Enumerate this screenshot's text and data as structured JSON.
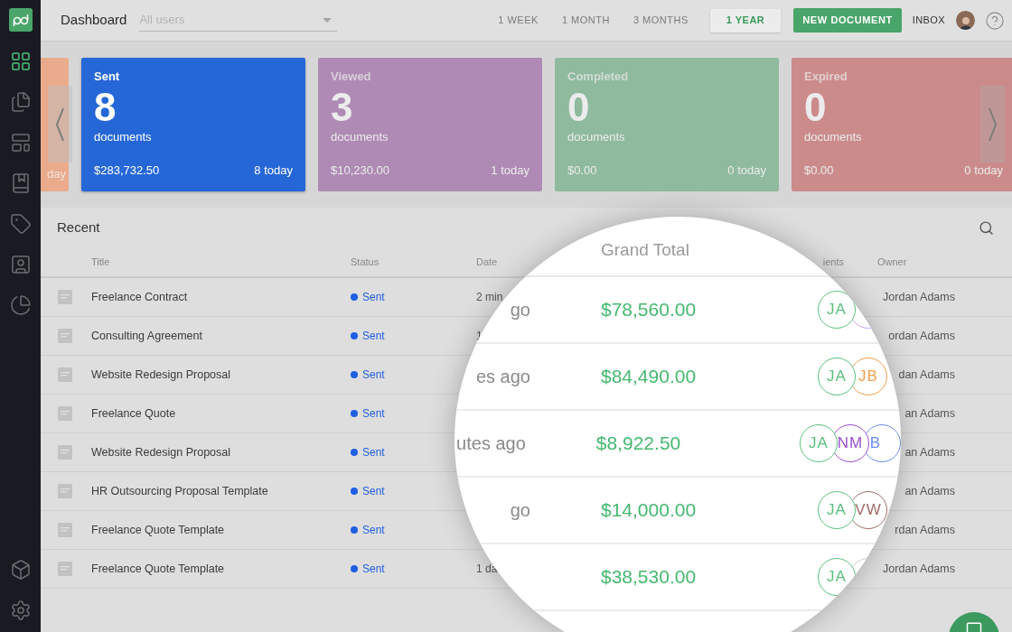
{
  "sidebar": {
    "items": [
      {
        "kind": "dashboard",
        "selected": true
      },
      {
        "kind": "documents",
        "selected": false
      },
      {
        "kind": "templates",
        "selected": false
      },
      {
        "kind": "library",
        "selected": false
      },
      {
        "kind": "catalog",
        "selected": false
      },
      {
        "kind": "contacts",
        "selected": false
      },
      {
        "kind": "reports",
        "selected": false
      }
    ],
    "bottom_items": [
      {
        "kind": "integrations",
        "selected": false
      },
      {
        "kind": "settings",
        "selected": false
      }
    ]
  },
  "header": {
    "title": "Dashboard",
    "user_filter": {
      "placeholder": "All users"
    },
    "periods": [
      {
        "label": "1 WEEK",
        "selected": false
      },
      {
        "label": "1 MONTH",
        "selected": false
      },
      {
        "label": "3 MONTHS",
        "selected": false
      },
      {
        "label": "1 YEAR",
        "selected": true
      }
    ],
    "new_button": "NEW DOCUMENT",
    "inbox": "INBOX"
  },
  "carousel": {
    "partial_card": {
      "color": "#e9ab8c",
      "footer": "day"
    },
    "cards": [
      {
        "title": "Sent",
        "count": "8",
        "unit": "documents",
        "amount": "$283,732.50",
        "today": "8 today",
        "color": "#2667d8",
        "selected": true
      },
      {
        "title": "Viewed",
        "count": "3",
        "unit": "documents",
        "amount": "$10,230.00",
        "today": "1 today",
        "color": "#ae8ab4",
        "selected": false
      },
      {
        "title": "Completed",
        "count": "0",
        "unit": "documents",
        "amount": "$0.00",
        "today": "0 today",
        "color": "#8fba9e",
        "selected": false
      },
      {
        "title": "Expired",
        "count": "0",
        "unit": "documents",
        "amount": "$0.00",
        "today": "0 today",
        "color": "#cc8b8b",
        "selected": false
      }
    ]
  },
  "recent": {
    "title": "Recent",
    "columns": [
      "Title",
      "Status",
      "Date",
      "ients",
      "Owner"
    ],
    "rows": [
      {
        "title": "Freelance Contract",
        "status": "Sent",
        "date": "2 min",
        "owner": "Jordan Adams"
      },
      {
        "title": "Consulting Agreement",
        "status": "Sent",
        "date": "1",
        "owner": "ordan Adams"
      },
      {
        "title": "Website Redesign Proposal",
        "status": "Sent",
        "owner": "dan Adams"
      },
      {
        "title": "Freelance Quote",
        "status": "Sent",
        "owner": "an Adams"
      },
      {
        "title": "Website Redesign Proposal",
        "status": "Sent",
        "owner": "an Adams"
      },
      {
        "title": "HR Outsourcing Proposal Template",
        "status": "Sent",
        "owner": "an Adams"
      },
      {
        "title": "Freelance Quote Template",
        "status": "Sent",
        "owner": "rdan Adams"
      },
      {
        "title": "Freelance Quote Template",
        "status": "Sent",
        "date": "1 da",
        "owner": "Jordan Adams"
      }
    ]
  },
  "magnifier": {
    "column": "Grand Total",
    "rows": [
      {
        "date": "go",
        "total": "$78,560.00",
        "recipients": [
          {
            "initials": "JA",
            "color": "#5cbf7f"
          },
          {
            "color": "#c9a6f2"
          }
        ]
      },
      {
        "date": "es ago",
        "total": "$84,490.00",
        "recipients": [
          {
            "initials": "JA",
            "color": "#5cbf7f"
          },
          {
            "initials": "JB",
            "color": "#f0a04b"
          }
        ]
      },
      {
        "date": "utes ago",
        "total": "$8,922.50",
        "recipients": [
          {
            "initials": "JA",
            "color": "#5cbf7f"
          },
          {
            "initials": "NM",
            "color": "#9b4fd0"
          },
          {
            "initials": "B",
            "color": "#6a8cf0"
          }
        ]
      },
      {
        "date": "go",
        "total": "$14,000.00",
        "recipients": [
          {
            "initials": "JA",
            "color": "#5cbf7f"
          },
          {
            "initials": "VW",
            "color": "#a06a6a"
          }
        ]
      },
      {
        "total": "$38,530.00",
        "recipients": [
          {
            "initials": "JA",
            "color": "#5cbf7f"
          },
          {
            "color": "#cccccc"
          }
        ]
      }
    ]
  }
}
